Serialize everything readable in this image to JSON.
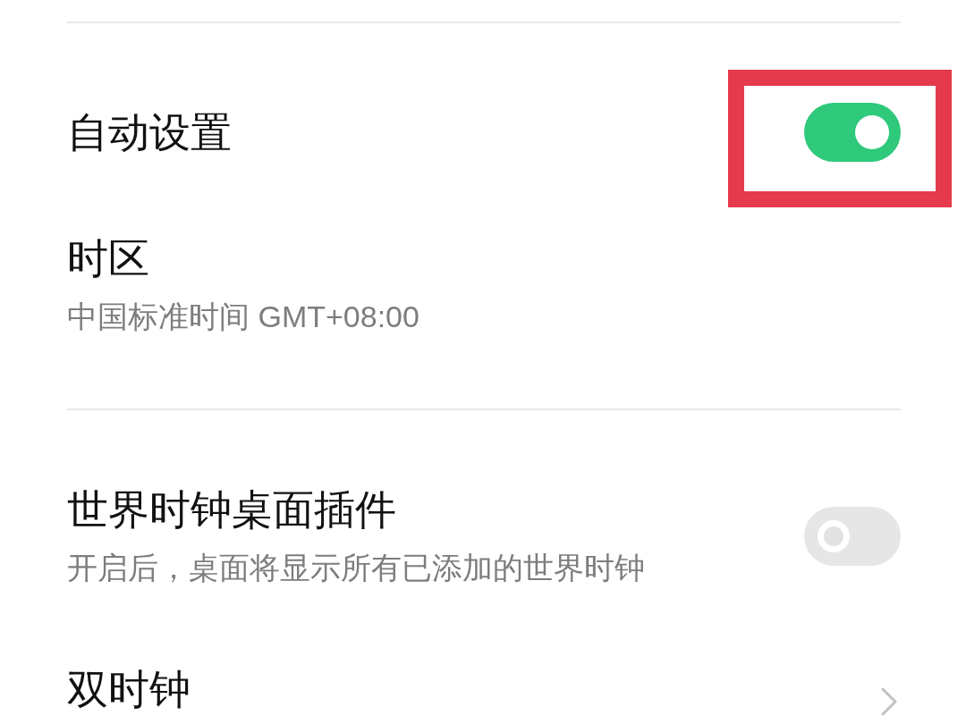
{
  "sections": [
    {
      "items": [
        {
          "kind": "toggle",
          "title": "自动设置",
          "on": true,
          "highlighted": true
        },
        {
          "kind": "info",
          "title": "时区",
          "subtitle": "中国标准时间 GMT+08:00",
          "highlighted": false
        }
      ]
    },
    {
      "items": [
        {
          "kind": "toggle",
          "title": "世界时钟桌面插件",
          "subtitle": "开启后，桌面将显示所有已添加的世界时钟",
          "on": false,
          "highlighted": false
        },
        {
          "kind": "link",
          "title": "双时钟",
          "highlighted": false
        }
      ]
    }
  ]
}
